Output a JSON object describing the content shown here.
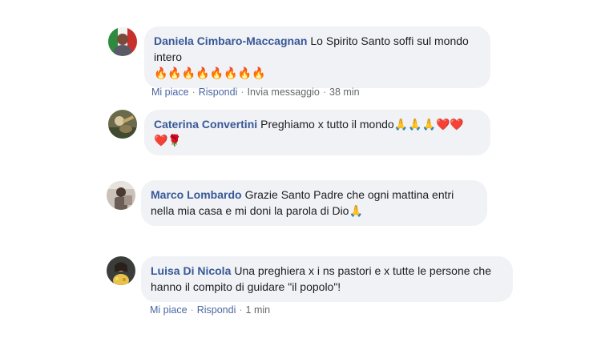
{
  "comments": [
    {
      "author": "Daniela Cimbaro-Maccagnan",
      "text": "Lo Spirito Santo soffi sul mondo intero",
      "emoji": "🔥🔥🔥🔥🔥🔥🔥🔥",
      "actions": {
        "like": "Mi piace",
        "reply": "Rispondi",
        "message": "Invia messaggio",
        "time": "38 min"
      }
    },
    {
      "author": "Caterina Convertini",
      "text": "Preghiamo x tutto il mondo🙏🙏🙏❤️❤️",
      "emoji": "❤️🌹"
    },
    {
      "author": "Marco Lombardo",
      "text": "Grazie Santo Padre che ogni mattina entri nella mia casa e mi doni la parola di Dio🙏"
    },
    {
      "author": "Luisa Di Nicola",
      "text": "Una preghiera x i ns pastori e x tutte le persone che hanno il compito di guidare \"il popolo\"!",
      "actions": {
        "like": "Mi piace",
        "reply": "Rispondi",
        "time": "1 min"
      }
    }
  ],
  "colors": {
    "author": "#385898",
    "bubble": "#f0f2f5",
    "action_link": "#4b67a1",
    "meta": "#65676b"
  }
}
